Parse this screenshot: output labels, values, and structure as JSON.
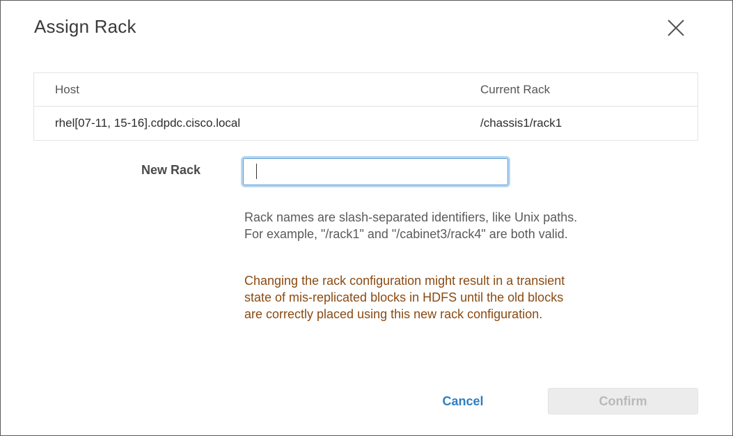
{
  "dialog": {
    "title": "Assign Rack",
    "close_icon": "close-icon"
  },
  "table": {
    "headers": {
      "host": "Host",
      "current_rack": "Current Rack"
    },
    "rows": [
      {
        "host": "rhel[07-11, 15-16].cdpdc.cisco.local",
        "current_rack": "/chassis1/rack1"
      }
    ]
  },
  "form": {
    "new_rack_label": "New Rack",
    "new_rack_value": "",
    "help_line1": "Rack names are slash-separated identifiers, like Unix paths.",
    "help_line2": "For example, \"/rack1\" and \"/cabinet3/rack4\" are both valid.",
    "warning_line1": "Changing the rack configuration might result in a transient",
    "warning_line2": "state of mis-replicated blocks in HDFS until the old blocks",
    "warning_line3": "are correctly placed using this new rack configuration."
  },
  "actions": {
    "cancel_label": "Cancel",
    "confirm_label": "Confirm",
    "confirm_enabled": false
  },
  "colors": {
    "accent": "#2f7fc1",
    "input_focus": "#5b9bd5",
    "warning": "#8a4a12",
    "disabled_text": "#b9b9b9"
  }
}
